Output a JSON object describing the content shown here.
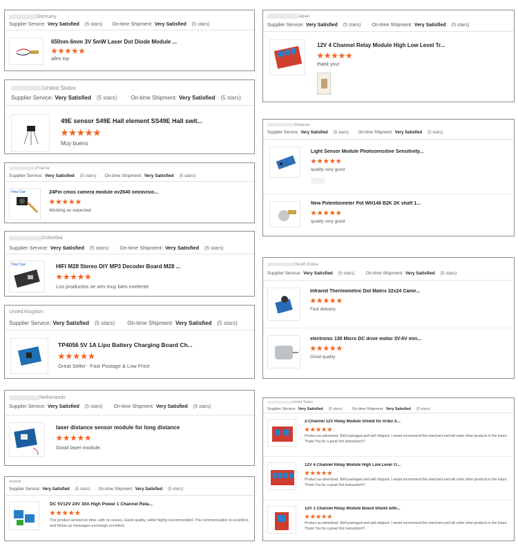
{
  "labels": {
    "supplier_service": "Supplier Service:",
    "on_time_shipment": "On-time Shipment:",
    "very_satisfied": "Very Satisfied",
    "five_stars": "(5 stars)",
    "stars": "★★★★★",
    "your_cart": "Your Car"
  },
  "reviews": [
    {
      "country": "Germany",
      "items": [
        {
          "title": "650nm 6mm 3V 5mW Laser Dot Diode Module ...",
          "review": "alles top"
        }
      ]
    },
    {
      "country": "United States",
      "items": [
        {
          "title": "49E sensor S49E Hall element SS49E Hall swit...",
          "review": "Muy bueno"
        }
      ]
    },
    {
      "country": "France",
      "items": [
        {
          "title": "24Pin cmos camera module ov2640 omnivisio...",
          "review": "Working as expected"
        }
      ]
    },
    {
      "country": "Colombia",
      "items": [
        {
          "title": "HIFI M28 Stereo DIY MP3 Decoder Board M28 ...",
          "review": "Los productos se ven muy bien exelente"
        }
      ]
    },
    {
      "country": "United Kingdom",
      "items": [
        {
          "title": "TP4056 5V 1A Lipo Battery Charging Board Ch...",
          "review": "Great Seller - Fast Postage & Low Price"
        }
      ]
    },
    {
      "country": "Netherlands",
      "items": [
        {
          "title": "laser distance sensor module for long distance",
          "review": "Good laser module."
        }
      ]
    },
    {
      "country": "Ireland",
      "items": [
        {
          "title": "DC 5V12V 24V 30A High Power 1 Channel Rela...",
          "review": "The product arrived on time, with no issues. Good quality, seller highly recommended. The communication is excellent, and follow up messages exchange excellent."
        }
      ]
    },
    {
      "country": "Japan",
      "items": [
        {
          "title": "12V 4 Channel Relay Module High Low Level Tr...",
          "review": "thank you!"
        }
      ]
    },
    {
      "country": "Malaysia",
      "items": [
        {
          "title": "Light Sensor Module Photosensitive Sensitivity...",
          "review": "quality very good"
        },
        {
          "title": "New Potentiometer Pot WH148 B2K 2K shaft 1...",
          "review": "quality very good"
        }
      ]
    },
    {
      "country": "South Korea",
      "items": [
        {
          "title": "Infrared Thermometric Dot Matrix 32x24 Came...",
          "review": "Fast delivery"
        },
        {
          "title": "electronic 130 Micro DC drive motor 3V-6V min...",
          "review": "Good quality"
        }
      ]
    },
    {
      "country": "United States",
      "items": [
        {
          "title": "2-Channel 12V Relay Module Shield for Ardui A...",
          "review": "Product as advertised. Well packaged and well shipped. I would recommend this merchant and will order other products in the future.  Thank You for a great first transaction!!!"
        },
        {
          "title": "12V 4 Channel Relay Module High Low Level Tr...",
          "review": "Product as advertised. Well packaged and well shipped. I would recommend this merchant and will order other products in the future.  Thank You for a great first transaction!!!"
        },
        {
          "title": "12V 1 Channel Relay Module Board Shield with...",
          "review": "Product as advertised. Well packaged and well shipped. I would recommend this merchant and will order other products in the future.  Thank You for a great first transaction!!!"
        }
      ]
    }
  ]
}
